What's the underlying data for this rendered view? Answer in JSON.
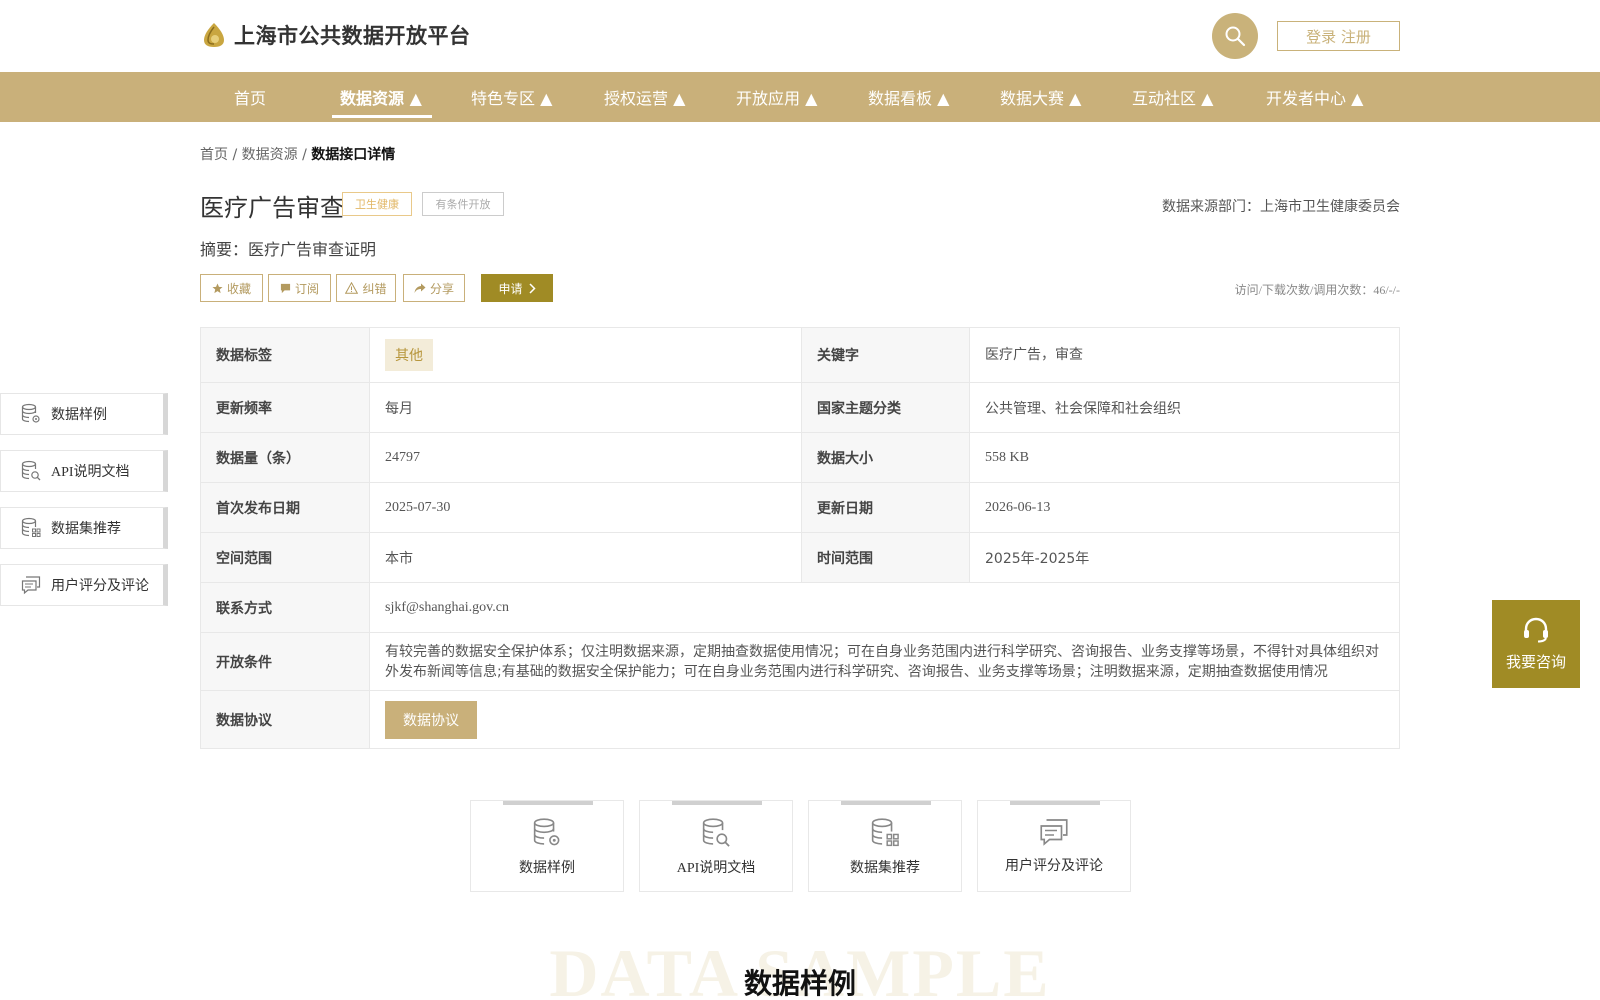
{
  "header": {
    "site_title": "上海市公共数据开放平台",
    "login_label": "登录 注册",
    "brand_color": "#c9b07a"
  },
  "nav": {
    "items": [
      {
        "label": "首页",
        "active": false
      },
      {
        "label": "数据资源 ▲",
        "active": true
      },
      {
        "label": "特色专区 ▲",
        "active": false
      },
      {
        "label": "授权运营 ▲",
        "active": false
      },
      {
        "label": "开放应用 ▲",
        "active": false
      },
      {
        "label": "数据看板 ▲",
        "active": false
      },
      {
        "label": "数据大赛 ▲",
        "active": false
      },
      {
        "label": "互动社区 ▲",
        "active": false
      },
      {
        "label": "开发者中心 ▲",
        "active": false
      }
    ]
  },
  "breadcrumb": {
    "home": "首页",
    "sep": " / ",
    "section": "数据资源",
    "current": "数据接口详情"
  },
  "detail": {
    "title": "医疗广告审查",
    "tag_domain": "卫生健康",
    "tag_open": "有条件开放",
    "dept": "数据来源部门：上海市卫生健康委员会",
    "abstract": "摘要：医疗广告审查证明",
    "actions": {
      "favorite": "收藏",
      "subscribe": "订阅",
      "report": "纠错",
      "share": "分享",
      "apply": "申请"
    },
    "visits": "访问/下载次数/调用次数：46/-/-"
  },
  "table": {
    "tags_label": "数据标签",
    "tags_value": "其他",
    "keywords_label": "关键字",
    "keywords_value": "医疗广告，审查",
    "freq_label": "更新频率",
    "freq_value": "每月",
    "topic_label": "国家主题分类",
    "topic_value": "公共管理、社会保障和社会组织",
    "count_label": "数据量（条）",
    "count_value": "24797",
    "size_label": "数据大小",
    "size_value": "558 KB",
    "first_label": "首次发布日期",
    "first_value": "2025-07-30",
    "update_label": "更新日期",
    "update_value": "2026-06-13",
    "space_label": "空间范围",
    "space_value": "本市",
    "time_label": "时间范围",
    "time_value": "2025年-2025年",
    "contact_label": "联系方式",
    "contact_value": "sjkf@shanghai.gov.cn",
    "cond_label": "开放条件",
    "cond_value": "有较完善的数据安全保护体系；仅注明数据来源，定期抽查数据使用情况；可在自身业务范围内进行科学研究、咨询报告、业务支撑等场景，不得针对具体组织对外发布新闻等信息;有基础的数据安全保护能力；可在自身业务范围内进行科学研究、咨询报告、业务支撑等场景；注明数据来源，定期抽查数据使用情况",
    "agree_label": "数据协议",
    "agree_button": "数据协议"
  },
  "side_menu": {
    "items": [
      {
        "label": "数据样例",
        "icon": "database-gear-icon"
      },
      {
        "label": "API说明文档",
        "icon": "database-search-icon"
      },
      {
        "label": "数据集推荐",
        "icon": "database-grid-icon"
      },
      {
        "label": "用户评分及评论",
        "icon": "comment-icon"
      }
    ]
  },
  "consult": {
    "label": "我要咨询",
    "icon": "headset-icon"
  },
  "cards": {
    "items": [
      {
        "label": "数据样例",
        "icon": "database-gear-icon"
      },
      {
        "label": "API说明文档",
        "icon": "database-search-icon"
      },
      {
        "label": "数据集推荐",
        "icon": "database-grid-icon"
      },
      {
        "label": "用户评分及评论",
        "icon": "comment-icon"
      }
    ]
  },
  "section": {
    "bg_text": "DATA SAMPLE",
    "title": "数据样例"
  }
}
